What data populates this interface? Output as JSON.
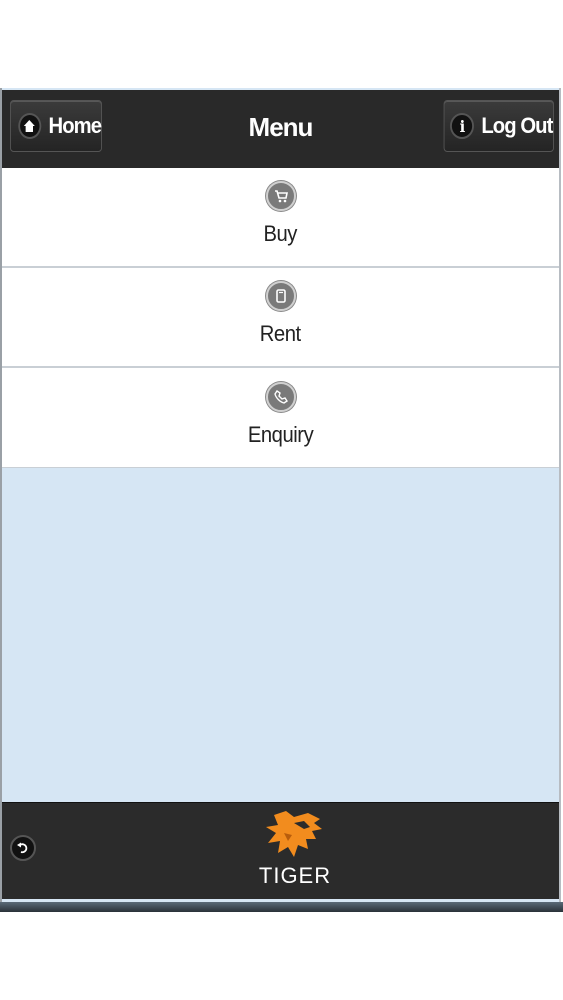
{
  "header": {
    "home_label": "Home",
    "title": "Menu",
    "logout_label": "Log Out",
    "home_icon": "home-icon",
    "info_icon": "info-icon"
  },
  "menu": {
    "items": [
      {
        "label": "Buy",
        "icon": "cart-icon"
      },
      {
        "label": "Rent",
        "icon": "tablet-icon"
      },
      {
        "label": "Enquiry",
        "icon": "phone-icon"
      }
    ]
  },
  "footer": {
    "back_icon": "back-icon",
    "logo_text": "TIGER"
  },
  "colors": {
    "header_bg": "#292929",
    "content_bg": "#d6e6f4",
    "logo_orange": "#f28c1e"
  }
}
